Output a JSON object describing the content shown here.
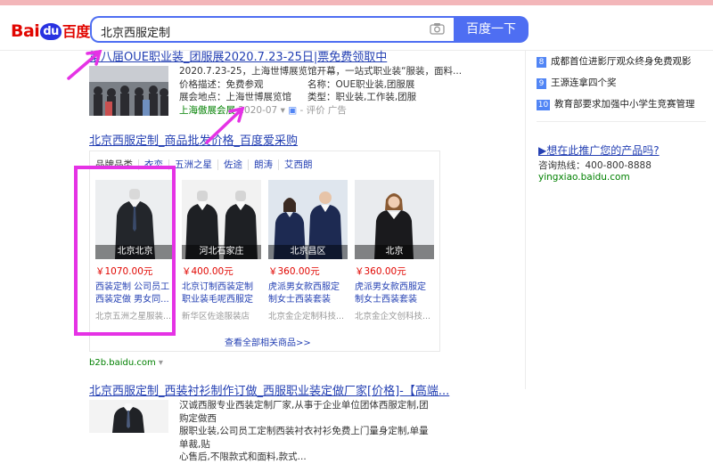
{
  "header": {
    "logo_bai": "Bai",
    "logo_du": "du",
    "logo_cn": "百度",
    "query": "北京西服定制",
    "search_button": "百度一下"
  },
  "result1": {
    "title": "第八届OUE职业装_团服展2020.7.23-25日|票免费领取中",
    "line1": "2020.7.23-25，上海世博展览馆开幕，一站式职业装“服装，面料...",
    "price_label": "价格描述：免费参观",
    "name_label": "名称：OUE职业装,团服展",
    "venue_label": "展会地点：上海世博展览馆",
    "type_label": "类型：职业装,工作装,团服",
    "source": "上海傲展会展",
    "date": "2020-07",
    "tail": "- 评价  广告"
  },
  "result2": {
    "title": "北京西服定制_商品批发价格_百度爱采购",
    "tabs": [
      "品牌品类",
      "衣恋",
      "五洲之星",
      "佐途",
      "朗涛",
      "艾西朗"
    ],
    "products": [
      {
        "caption": "北京北京",
        "price": "￥1070.00元",
        "desc": "西装定制 公司员工西装定做 男女同...",
        "shop": "北京五洲之星服装..."
      },
      {
        "caption": "河北石家庄",
        "price": "￥400.00元",
        "desc": "北京订制西装定制职业装毛呢西服定做",
        "shop": "新华区佐途服装店"
      },
      {
        "caption": "北京昌区",
        "price": "￥360.00元",
        "desc": "虎派男女款西服定制女士西装套装批...",
        "shop": "北京金企定制科技..."
      },
      {
        "caption": "北京",
        "price": "￥360.00元",
        "desc": "虎派男女款西服定制女士西装套装批...",
        "shop": "北京金企文创科技..."
      }
    ],
    "more": "查看全部相关商品>>",
    "source": "b2b.baidu.com"
  },
  "result3": {
    "title": "北京西服定制_西装衬衫制作订做_西服职业装定做厂家[价格]-【高端...",
    "line1": "汉诚西服专业西装定制厂家,从事于企业单位团体西服定制,团购定做西",
    "line2": "服职业装,公司员工定制西装衬衣衬衫免费上门量身定制,单量单裁,贴",
    "line3": "心售后,不限款式和面料,款式..."
  },
  "sidebar": {
    "hot": [
      {
        "num": "8",
        "text": "成都首位进影厅观众终身免费观影"
      },
      {
        "num": "9",
        "text": "王源连拿四个奖"
      },
      {
        "num": "10",
        "text": "教育部要求加强中小学生竞赛管理"
      }
    ],
    "ad_title": "▶想在此推广您的产品吗?",
    "ad_phone": "咨询热线：400-800-8888",
    "ad_url": "yingxiao.baidu.com"
  },
  "colors": {
    "accent": "#4e6ef2",
    "link": "#2440b3",
    "highlight": "#e532e5",
    "price": "#e10601"
  }
}
